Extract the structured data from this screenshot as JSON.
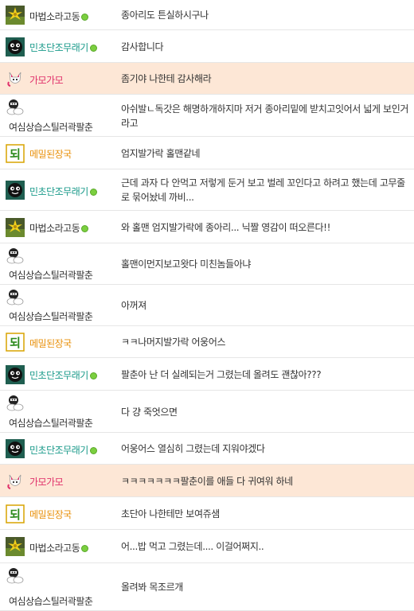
{
  "colors": {
    "highlight_row": "#fde7d6",
    "name_default": "#333333",
    "name_teal": "#1a9a8a",
    "name_pink": "#e0306a",
    "name_orange": "#e8900a",
    "online_dot": "#7bcf3f"
  },
  "comments": [
    {
      "user": "마법소라고동",
      "avatar": "flower-avatar-icon",
      "online": true,
      "name_color": "default",
      "highlight": false,
      "text": "종아리도 튼실하시구나"
    },
    {
      "user": "민초단조무래기",
      "avatar": "mint-ball-avatar-icon",
      "online": true,
      "name_color": "teal",
      "highlight": false,
      "text": "감사합니다"
    },
    {
      "user": "가모가모",
      "avatar": "fox-avatar-icon",
      "online": false,
      "name_color": "pink",
      "highlight": true,
      "text": "좀기야 나한테 감사해라"
    },
    {
      "user": "여심상습스틸러곽팔춘",
      "avatar": "ninja-avatar-icon",
      "online": false,
      "name_color": "default",
      "highlight": false,
      "text": "아쉬발ㄴ독갓은 해명하개하지마 저거 종아리밑에 받치고잇어서 넓게 보인거라고"
    },
    {
      "user": "메밀된장국",
      "avatar": "doenjang-avatar-icon",
      "online": false,
      "name_color": "orange",
      "highlight": false,
      "text": "엄지발가락 홀맨같네"
    },
    {
      "user": "민초단조무래기",
      "avatar": "mint-ball-avatar-icon",
      "online": true,
      "name_color": "teal",
      "highlight": false,
      "text": "근데 과자 다 안먹고 저렇게 둔거 보고 벌레 꼬인다고 하려고 했는데 고무줄로 묶어놨네 까비..."
    },
    {
      "user": "마법소라고동",
      "avatar": "flower-avatar-icon",
      "online": true,
      "name_color": "default",
      "highlight": false,
      "text": "와 홀맨 엄지발가락에 종아리... 닉짤 영감이 떠오른다!!"
    },
    {
      "user": "여심상습스틸러곽팔춘",
      "avatar": "ninja-avatar-icon",
      "online": false,
      "name_color": "default",
      "highlight": false,
      "text": "홀맨이먼지보고왓다 미친놈들아냐"
    },
    {
      "user": "여심상습스틸러곽팔춘",
      "avatar": "ninja-avatar-icon",
      "online": false,
      "name_color": "default",
      "highlight": false,
      "text": "아꺼져"
    },
    {
      "user": "메밀된장국",
      "avatar": "doenjang-avatar-icon",
      "online": false,
      "name_color": "orange",
      "highlight": false,
      "text": "ㅋㅋ나머지발가락 어웅어스"
    },
    {
      "user": "민초단조무래기",
      "avatar": "mint-ball-avatar-icon",
      "online": true,
      "name_color": "teal",
      "highlight": false,
      "text": "팔춘아 난 더 실례되는거 그렸는데 올려도 괜찮아???"
    },
    {
      "user": "여심상습스틸러곽팔춘",
      "avatar": "ninja-avatar-icon",
      "online": false,
      "name_color": "default",
      "highlight": false,
      "text": "다 걍 죽엇으면"
    },
    {
      "user": "민초단조무래기",
      "avatar": "mint-ball-avatar-icon",
      "online": true,
      "name_color": "teal",
      "highlight": false,
      "text": "어웅어스 열심히 그렸는데 지워야겠다"
    },
    {
      "user": "가모가모",
      "avatar": "fox-avatar-icon",
      "online": false,
      "name_color": "pink",
      "highlight": true,
      "text": "ㅋㅋㅋㅋㅋㅋㅋ팔춘이를 애들 다 귀여워 하네"
    },
    {
      "user": "메밀된장국",
      "avatar": "doenjang-avatar-icon",
      "online": false,
      "name_color": "orange",
      "highlight": false,
      "text": "초단아 나한테만 보여쥬샘"
    },
    {
      "user": "마법소라고동",
      "avatar": "flower-avatar-icon",
      "online": true,
      "name_color": "default",
      "highlight": false,
      "text": "어...밥 먹고 그렸는데.... 이걸어쩌지.."
    },
    {
      "user": "여심상습스틸러곽팔춘",
      "avatar": "ninja-avatar-icon",
      "online": false,
      "name_color": "default",
      "highlight": false,
      "text": "올려봐 목조르개"
    }
  ]
}
